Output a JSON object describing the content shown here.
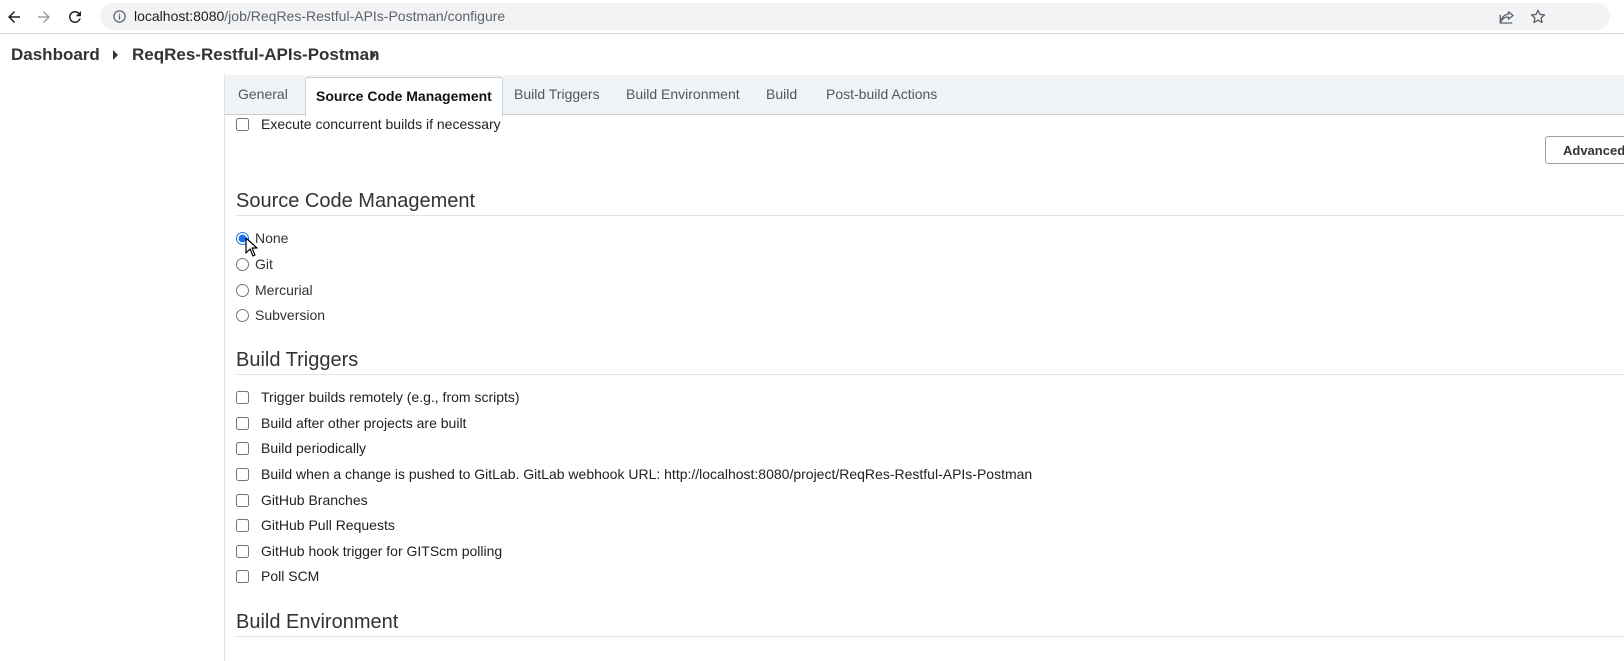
{
  "browser": {
    "url_host": "localhost:8080",
    "url_path": "/job/ReqRes-Restful-APIs-Postman/configure",
    "icons": [
      "back-arrow-icon",
      "forward-arrow-icon",
      "reload-icon",
      "site-info-icon",
      "share-icon",
      "bookmark-star-icon"
    ]
  },
  "breadcrumb": {
    "items": [
      "Dashboard",
      "ReqRes-Restful-APIs-Postman"
    ]
  },
  "tabs": [
    {
      "label": "General",
      "active": false
    },
    {
      "label": "Source Code Management",
      "active": true
    },
    {
      "label": "Build Triggers",
      "active": false
    },
    {
      "label": "Build Environment",
      "active": false
    },
    {
      "label": "Build",
      "active": false
    },
    {
      "label": "Post-build Actions",
      "active": false
    }
  ],
  "general": {
    "concurrent_label": "Execute concurrent builds if necessary",
    "advanced_button": "Advanced..."
  },
  "scm": {
    "title": "Source Code Management",
    "options": [
      "None",
      "Git",
      "Mercurial",
      "Subversion"
    ],
    "selected": "None"
  },
  "triggers": {
    "title": "Build Triggers",
    "options": [
      "Trigger builds remotely (e.g., from scripts)",
      "Build after other projects are built",
      "Build periodically",
      "Build when a change is pushed to GitLab. GitLab webhook URL: http://localhost:8080/project/ReqRes-Restful-APIs-Postman",
      "GitHub Branches",
      "GitHub Pull Requests",
      "GitHub hook trigger for GITScm polling",
      "Poll SCM"
    ]
  },
  "environment": {
    "title": "Build Environment"
  },
  "colors": {
    "tabbar_bg": "#f0f4f7",
    "radio_accent": "#1a73e8"
  }
}
